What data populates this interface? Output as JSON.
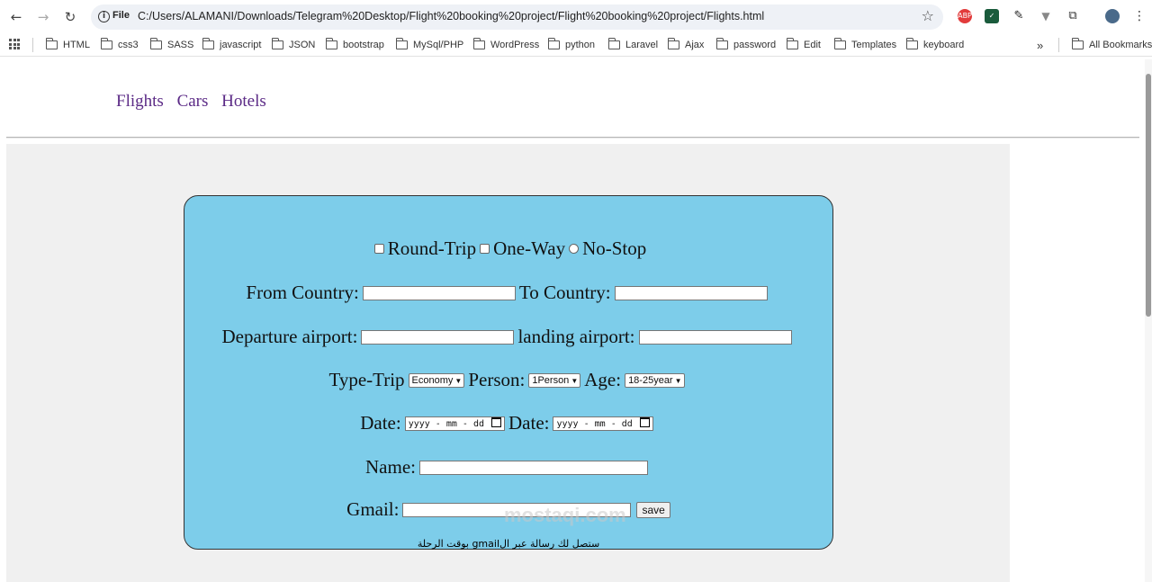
{
  "browser": {
    "file_chip": "File",
    "url": "C:/Users/ALAMANI/Downloads/Telegram%20Desktop/Flight%20booking%20project/Flight%20booking%20project/Flights.html",
    "extensions": [
      "ABP"
    ],
    "bookmarks": [
      "HTML",
      "css3",
      "SASS",
      "javascript",
      "JSON",
      "bootstrap",
      "MySql/PHP",
      "WordPress",
      "python",
      "Laravel",
      "Ajax",
      "password",
      "Edit",
      "Templates",
      "keyboard"
    ],
    "more": "»",
    "all_bookmarks": "All Bookmarks"
  },
  "site_nav": [
    "Flights",
    "Cars",
    "Hotels"
  ],
  "form": {
    "trip_options": [
      "Round-Trip",
      "One-Way",
      "No-Stop"
    ],
    "from_country": "From Country:",
    "to_country": "To Country:",
    "departure_airport": "Departure airport:",
    "landing_airport": "landing airport:",
    "type_trip": "Type-Trip",
    "type_trip_value": "Economy",
    "person": "Person:",
    "person_value": "1Person",
    "age": "Age:",
    "age_value": "18-25year",
    "date1": "Date:",
    "date2": "Date:",
    "date_placeholder": "yyyy - mm - dd",
    "name": "Name:",
    "gmail": "Gmail:",
    "save": "save",
    "note": "ستصل لك رسالة عبر الgmail بوقت الرحلة"
  },
  "watermark": "mostaqi.com"
}
